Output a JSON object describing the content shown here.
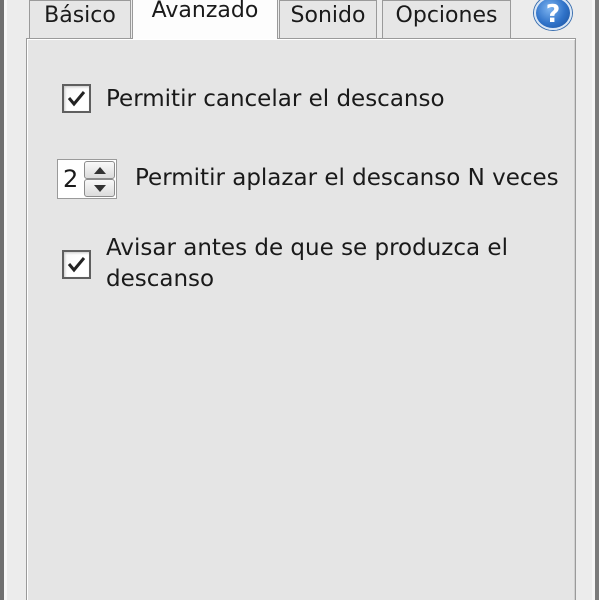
{
  "tabs": [
    {
      "label": "Básico",
      "active": false
    },
    {
      "label": "Avanzado",
      "active": true
    },
    {
      "label": "Sonido",
      "active": false
    },
    {
      "label": "Opciones",
      "active": false
    }
  ],
  "help": {
    "glyph": "?",
    "icon": "help-icon"
  },
  "options": {
    "allow_cancel": {
      "label": "Permitir cancelar el descanso",
      "checked": true
    },
    "allow_postpone": {
      "value": "2",
      "label": "Permitir aplazar el descanso N veces"
    },
    "warn_before": {
      "line1": "Avisar antes de que se produzca el",
      "line2": "descanso",
      "checked": true
    }
  },
  "colors": {
    "accent": "#2f72c8",
    "panel": "#e5e5e5",
    "active_tab": "#fdfdfd"
  }
}
